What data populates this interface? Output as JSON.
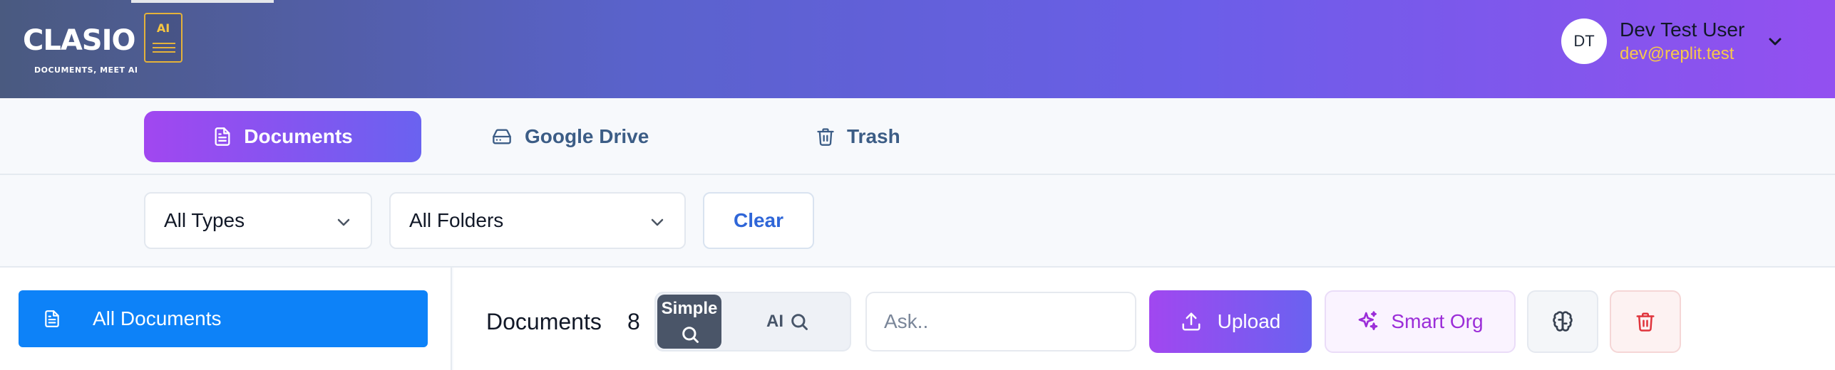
{
  "app": {
    "logo_text": "CLASIO",
    "logo_tagline": "DOCUMENTS, MEET AI",
    "logo_badge": "AI"
  },
  "user": {
    "initials": "DT",
    "name": "Dev Test User",
    "email": "dev@replit.test"
  },
  "nav": {
    "tabs": [
      {
        "label": "Documents",
        "icon": "document-icon",
        "active": true
      },
      {
        "label": "Google Drive",
        "icon": "drive-icon",
        "active": false
      },
      {
        "label": "Trash",
        "icon": "trash-icon",
        "active": false
      }
    ]
  },
  "filters": {
    "type_value": "All Types",
    "folder_value": "All Folders",
    "clear_label": "Clear"
  },
  "sidebar": {
    "items": [
      {
        "label": "All Documents",
        "icon": "document-icon",
        "active": true
      }
    ]
  },
  "main": {
    "title": "Documents",
    "count": "8",
    "search_mode": {
      "simple_label": "Simple",
      "ai_label": "AI",
      "selected": "Simple"
    },
    "ask_placeholder": "Ask..",
    "upload_label": "Upload",
    "smart_org_label": "Smart Org"
  },
  "colors": {
    "brand_gradient_start": "#a147f0",
    "brand_gradient_end": "#6a62f0",
    "sidebar_active": "#0d82f8",
    "link_blue": "#2f66d8",
    "smart_org_purple": "#9b2dd8",
    "email_yellow": "#f8c84a",
    "danger_red": "#e0343c"
  }
}
